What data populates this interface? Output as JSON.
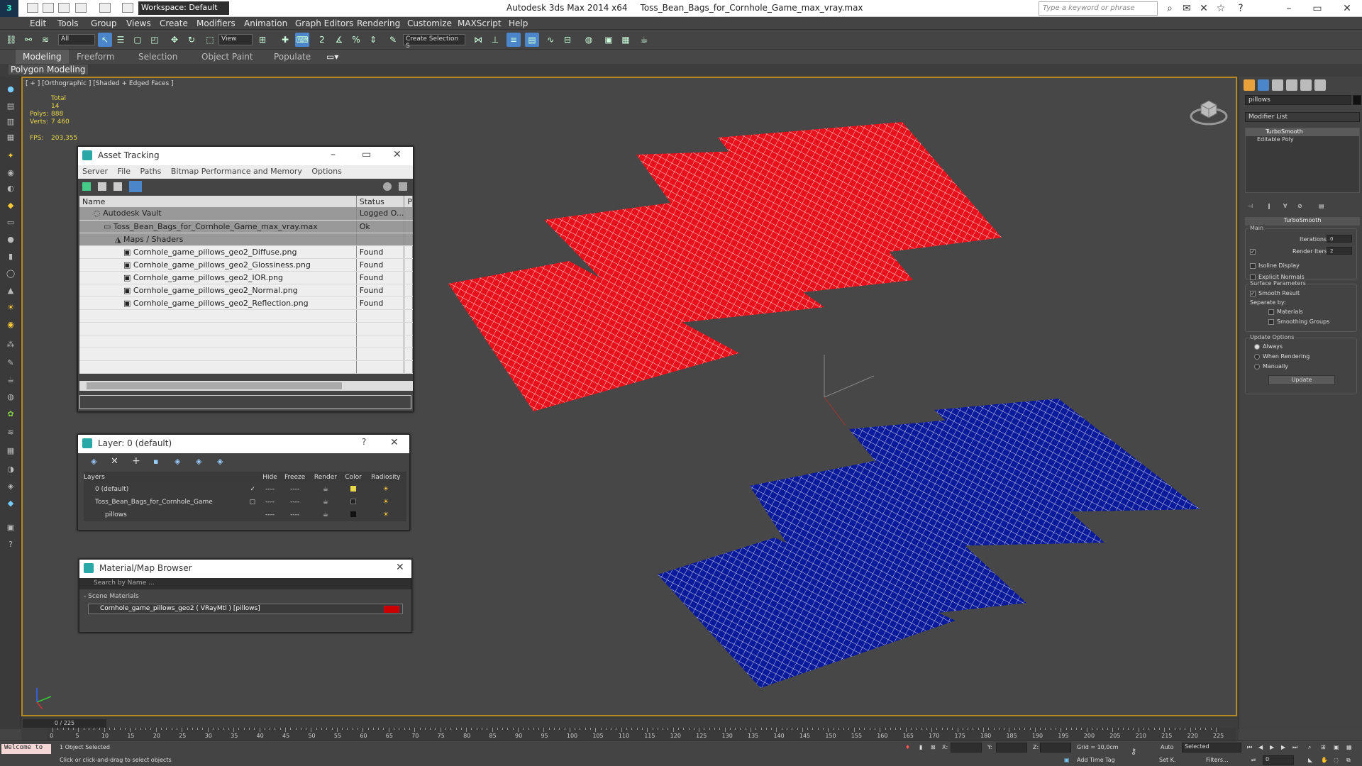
{
  "title": {
    "app": "Autodesk 3ds Max  2014 x64",
    "file": "Toss_Bean_Bags_for_Cornhole_Game_max_vray.max"
  },
  "workspace": "Workspace: Default",
  "search_placeholder": "Type a keyword or phrase",
  "menu": [
    "Edit",
    "Tools",
    "Group",
    "Views",
    "Create",
    "Modifiers",
    "Animation",
    "Graph Editors",
    "Rendering",
    "Customize",
    "MAXScript",
    "Help"
  ],
  "toolbar": {
    "filter": "All",
    "coord": "View",
    "selset": "Create Selection S"
  },
  "ribbon": {
    "tabs": [
      "Modeling",
      "Freeform",
      "Selection",
      "Object Paint",
      "Populate"
    ],
    "sub": "Polygon Modeling"
  },
  "viewport": {
    "label": "[ + ] [Orthographic ] [Shaded + Edged Faces ]",
    "stats": {
      "total": "Total",
      "polys_label": "Polys:",
      "polys": "14 888",
      "verts_label": "Verts:",
      "verts": "7 460",
      "fps_label": "FPS:",
      "fps": "203,355"
    }
  },
  "asset": {
    "title": "Asset Tracking",
    "menu": [
      "Server",
      "File",
      "Paths",
      "Bitmap Performance and Memory",
      "Options"
    ],
    "cols": [
      "Name",
      "Status",
      "P"
    ],
    "rows": [
      {
        "name": "Autodesk Vault",
        "status": "Logged O..."
      },
      {
        "name": "Toss_Bean_Bags_for_Cornhole_Game_max_vray.max",
        "status": "Ok"
      },
      {
        "name": "Maps / Shaders",
        "status": ""
      },
      {
        "name": "Cornhole_game_pillows_geo2_Diffuse.png",
        "status": "Found"
      },
      {
        "name": "Cornhole_game_pillows_geo2_Glossiness.png",
        "status": "Found"
      },
      {
        "name": "Cornhole_game_pillows_geo2_IOR.png",
        "status": "Found"
      },
      {
        "name": "Cornhole_game_pillows_geo2_Normal.png",
        "status": "Found"
      },
      {
        "name": "Cornhole_game_pillows_geo2_Reflection.png",
        "status": "Found"
      }
    ]
  },
  "layer": {
    "title": "Layer: 0 (default)",
    "help": "?",
    "cols": [
      "Layers",
      "Hide",
      "Freeze",
      "Render",
      "Color",
      "Radiosity"
    ],
    "rows": [
      {
        "name": "0 (default)",
        "color": "#e8d84a"
      },
      {
        "name": "Toss_Bean_Bags_for_Cornhole_Game",
        "color": "#222222"
      },
      {
        "name": "pillows",
        "color": "#111111"
      }
    ],
    "dash": "----"
  },
  "matbrowser": {
    "title": "Material/Map Browser",
    "search": "Search by Name ...",
    "section": "- Scene Materials",
    "item": "Cornhole_game_pillows_geo2 ( VRayMtl ) [pillows]"
  },
  "cmd": {
    "name": "pillows",
    "modlist": "Modifier List",
    "stack": [
      "TurboSmooth",
      "Editable Poly"
    ],
    "rollout": "TurboSmooth",
    "main": "Main",
    "iterations": "Iterations:",
    "iter_val": "0",
    "render_iters": "Render Iters:",
    "render_val": "2",
    "isoline": "Isoline Display",
    "explicit": "Explicit Normals",
    "surface": "Surface Parameters",
    "smooth": "Smooth Result",
    "separate": "Separate by:",
    "materials": "Materials",
    "smoothing": "Smoothing Groups",
    "update_opts": "Update Options",
    "always": "Always",
    "when_rendering": "When Rendering",
    "manually": "Manually",
    "update": "Update"
  },
  "timeline": {
    "frame": "0 / 225",
    "ticks": [
      "0",
      "5",
      "10",
      "15",
      "20",
      "25",
      "30",
      "35",
      "40",
      "45",
      "50",
      "55",
      "60",
      "65",
      "70",
      "75",
      "80",
      "85",
      "90",
      "95",
      "100",
      "105",
      "110",
      "115",
      "120",
      "125",
      "130",
      "135",
      "140",
      "145",
      "150",
      "155",
      "160",
      "165",
      "170",
      "175",
      "180",
      "185",
      "190",
      "195",
      "200",
      "205",
      "210",
      "215",
      "220",
      "225"
    ]
  },
  "status": {
    "maxscript": "Welcome to",
    "selected": "1 Object Selected",
    "prompt": "Click or click-and-drag to select objects",
    "x": "X:",
    "y": "Y:",
    "z": "Z:",
    "grid": "Grid = 10,0cm",
    "auto": "Auto",
    "setk": "Set K.",
    "selected_dd": "Selected",
    "filters": "Filters...",
    "addtag": "Add Time Tag",
    "frame_val": "0"
  },
  "colors": {
    "red": "#e8101a",
    "blue": "#0a1a9a",
    "viewport_border": "#b88a1e"
  }
}
